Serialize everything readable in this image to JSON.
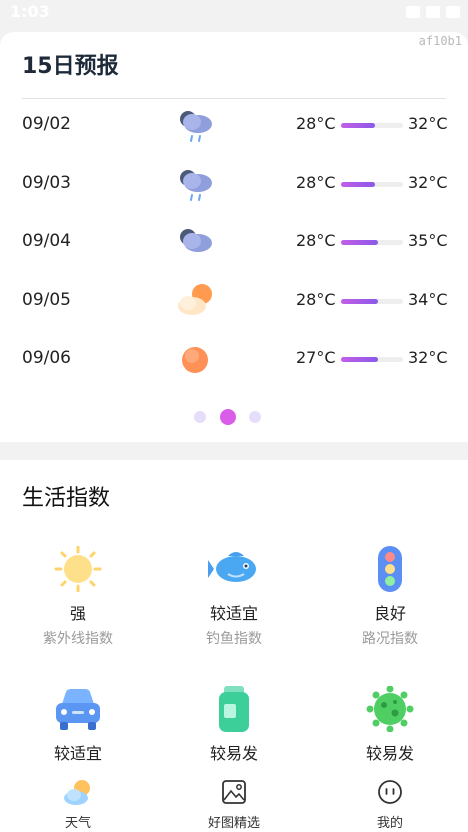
{
  "status_bar": {
    "time": "1:03"
  },
  "watermark": "af10b1",
  "forecast": {
    "title": "15日预报",
    "days": [
      {
        "date": "09/02",
        "icon": "rain-cloud-icon",
        "low": "28°C",
        "high": "32°C",
        "bar_start": 0.0,
        "bar_end": 0.55
      },
      {
        "date": "09/03",
        "icon": "rain-cloud-icon",
        "low": "28°C",
        "high": "32°C",
        "bar_start": 0.0,
        "bar_end": 0.55
      },
      {
        "date": "09/04",
        "icon": "cloudy-icon",
        "low": "28°C",
        "high": "35°C",
        "bar_start": 0.0,
        "bar_end": 0.6
      },
      {
        "date": "09/05",
        "icon": "partly-cloudy-icon",
        "low": "28°C",
        "high": "34°C",
        "bar_start": 0.0,
        "bar_end": 0.6
      },
      {
        "date": "09/06",
        "icon": "sun-icon",
        "low": "27°C",
        "high": "32°C",
        "bar_start": 0.0,
        "bar_end": 0.6
      }
    ],
    "page_indicator": {
      "count": 3,
      "active": 1
    }
  },
  "life_index": {
    "title": "生活指数",
    "items": [
      {
        "icon": "uv-sun-icon",
        "value": "强",
        "name": "紫外线指数"
      },
      {
        "icon": "fish-icon",
        "value": "较适宜",
        "name": "钓鱼指数"
      },
      {
        "icon": "traffic-light-icon",
        "value": "良好",
        "name": "路况指数"
      },
      {
        "icon": "car-icon",
        "value": "较适宜",
        "name": ""
      },
      {
        "icon": "bottle-icon",
        "value": "较易发",
        "name": ""
      },
      {
        "icon": "virus-icon",
        "value": "较易发",
        "name": ""
      }
    ]
  },
  "bottom_nav": [
    {
      "label": "天气",
      "icon": "weather-icon"
    },
    {
      "label": "好图精选",
      "icon": "image-icon"
    },
    {
      "label": "我的",
      "icon": "profile-icon"
    }
  ],
  "colors": {
    "bar_gradient_start": "#c35ee8",
    "bar_gradient_end": "#8b59e8",
    "dot_active": "#d95de8",
    "dot_inactive": "#e6ddfb"
  }
}
